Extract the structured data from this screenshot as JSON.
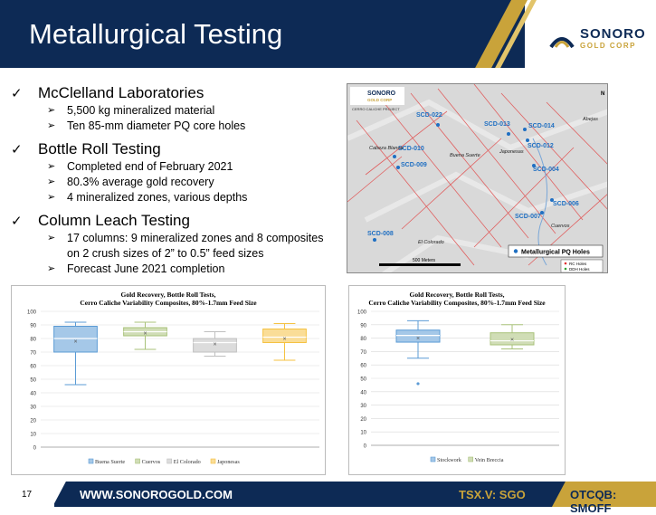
{
  "header": {
    "title": "Metallurgical Testing",
    "logo_line1": "SONORO",
    "logo_line2": "GOLD CORP"
  },
  "bullets": [
    {
      "label": "McClelland Laboratories",
      "subs": [
        "5,500 kg  mineralized material",
        "Ten 85-mm diameter PQ core  holes"
      ]
    },
    {
      "label": "Bottle Roll Testing",
      "subs": [
        "Completed end of February 2021",
        "80.3% average gold recovery",
        "4 mineralized zones, various depths"
      ]
    },
    {
      "label": "Column Leach Testing",
      "subs": [
        "17 columns: 9 mineralized zones and 8 composites",
        "on 2 crush sizes of 2” to 0.5” feed sizes",
        "Forecast June 2021 completion"
      ]
    }
  ],
  "map": {
    "logo1": "SONORO",
    "logo2": "GOLD CORP",
    "project": "CERRO CALICHE PROJECT",
    "holes": [
      "SCD-022",
      "SCD-013",
      "SCD-014",
      "SCD-012",
      "SCD-010",
      "SCD-009",
      "SCD-004",
      "SCD-006",
      "SCD-007",
      "SCD-008"
    ],
    "places": [
      "Abejas",
      "Cabeza Blanca",
      "Buena Suerte",
      "Japonesas",
      "Cuervos",
      "El Colorado"
    ],
    "legend_title": "Metallurgical PQ Holes",
    "legend_rc": "RC Holes",
    "legend_ddh": "DDH Holes",
    "scale": "500 Meters",
    "north": "N"
  },
  "chart_data": [
    {
      "type": "box",
      "title": "Gold Recovery, Bottle Roll Tests,",
      "subtitle": "Cerro Caliche Variability Composites, 80%-1.7mm Feed Size",
      "ylim": [
        0,
        100
      ],
      "yticks": [
        0,
        10,
        20,
        30,
        40,
        50,
        60,
        70,
        80,
        90,
        100
      ],
      "series": [
        {
          "name": "Buena Suerte",
          "color": "#5b9bd5",
          "min": 46,
          "q1": 70,
          "median": 80,
          "q3": 89,
          "max": 92,
          "mean": 78
        },
        {
          "name": "Cuervos",
          "color": "#a9c27a",
          "min": 72,
          "q1": 82,
          "median": 85,
          "q3": 88,
          "max": 92,
          "mean": 84
        },
        {
          "name": "El Colorado",
          "color": "#bfbfbf",
          "min": 67,
          "q1": 70,
          "median": 77,
          "q3": 80,
          "max": 85,
          "mean": 76
        },
        {
          "name": "Japonesas",
          "color": "#f5c242",
          "min": 64,
          "q1": 77,
          "median": 81,
          "q3": 87,
          "max": 91,
          "mean": 80
        }
      ]
    },
    {
      "type": "box",
      "title": "Gold Recovery, Bottle Roll Tests,",
      "subtitle": "Cerro Caliche Variability Composites, 80%-1.7mm Feed Size",
      "ylim": [
        0,
        100
      ],
      "yticks": [
        0,
        10,
        20,
        30,
        40,
        50,
        60,
        70,
        80,
        90,
        100
      ],
      "series": [
        {
          "name": "Stockwork",
          "color": "#5b9bd5",
          "min": 65,
          "q1": 77,
          "median": 82,
          "q3": 86,
          "max": 93,
          "mean": 80,
          "outliers": [
            46
          ]
        },
        {
          "name": "Vein Breccia",
          "color": "#a9c27a",
          "min": 72,
          "q1": 75,
          "median": 78,
          "q3": 84,
          "max": 90,
          "mean": 79
        }
      ]
    }
  ],
  "footer": {
    "page": "17",
    "url": "WWW.SONOROGOLD.COM",
    "tsx": "TSX.V: SGO",
    "otc": "OTCQB: SMOFF"
  }
}
